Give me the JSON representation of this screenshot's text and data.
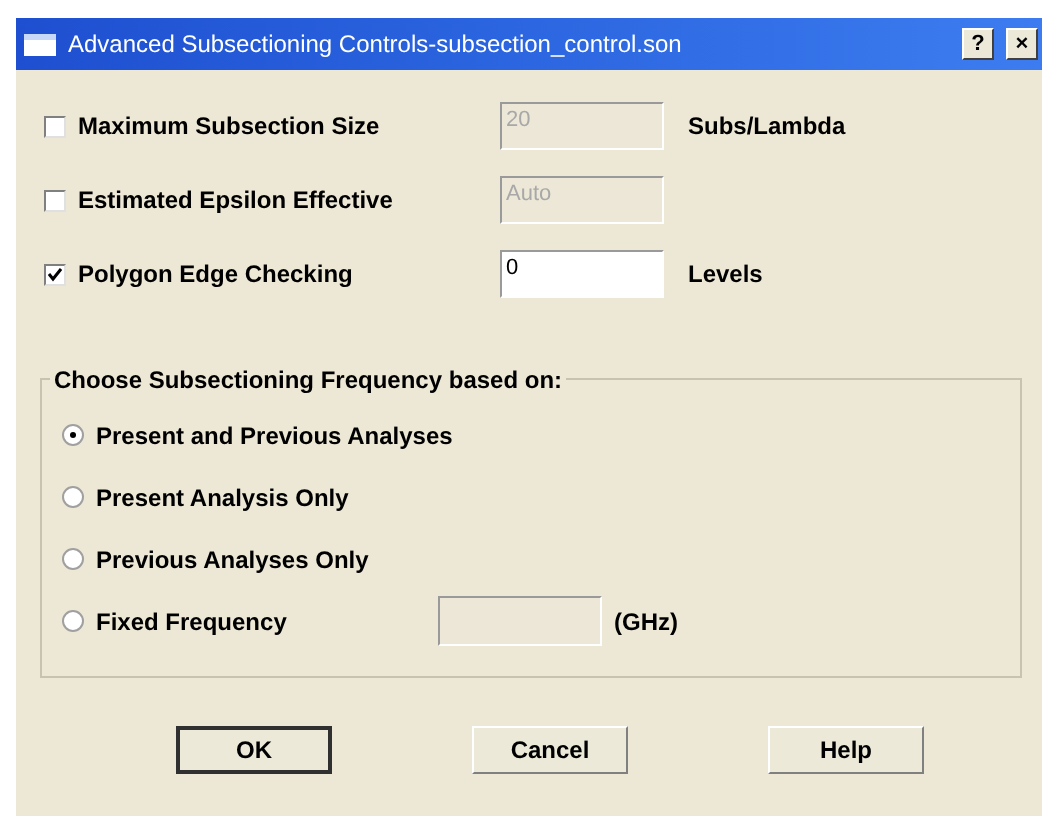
{
  "window": {
    "title": "Advanced Subsectioning Controls-subsection_control.son",
    "title_buttons": [
      "?",
      "×"
    ]
  },
  "options": [
    {
      "label": "Maximum Subsection Size",
      "checked": false,
      "value": "20",
      "disabled": true,
      "unit": "Subs/Lambda"
    },
    {
      "label": "Estimated Epsilon Effective",
      "checked": false,
      "value": "Auto",
      "disabled": true
    },
    {
      "label": "Polygon Edge Checking",
      "checked": true,
      "value": "0",
      "disabled": false,
      "unit": "Levels"
    }
  ],
  "frequency_group": {
    "title": "Choose Subsectioning Frequency based on:",
    "choices": [
      {
        "label": "Present and Previous Analyses",
        "selected": true
      },
      {
        "label": "Present Analysis Only",
        "selected": false
      },
      {
        "label": "Previous Analyses Only",
        "selected": false
      },
      {
        "label": "Fixed Frequency",
        "selected": false,
        "has_field": true,
        "unit": "(GHz)"
      }
    ]
  },
  "buttons": [
    {
      "label": "OK",
      "default": true
    },
    {
      "label": "Cancel",
      "default": false
    },
    {
      "label": "Help",
      "default": false
    }
  ]
}
